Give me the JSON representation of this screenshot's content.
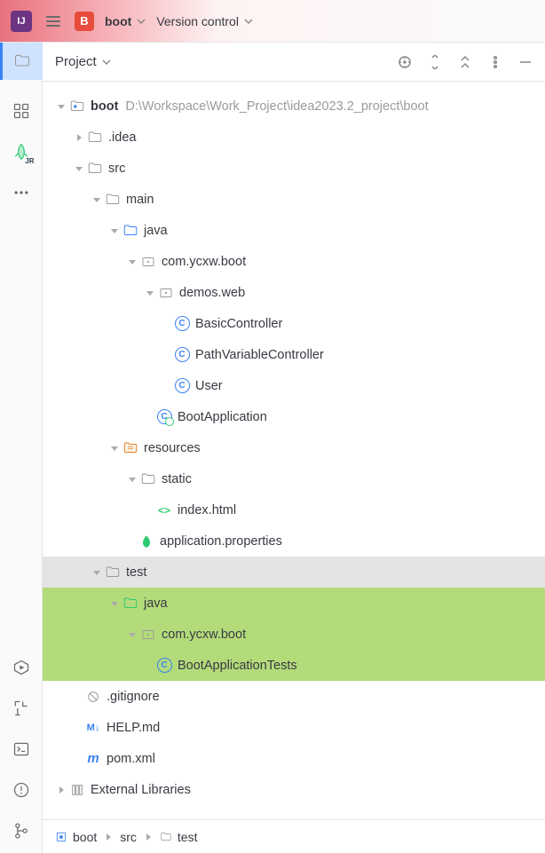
{
  "titlebar": {
    "project_badge": "B",
    "project_name": "boot",
    "vcs": "Version control"
  },
  "panel": {
    "title": "Project"
  },
  "tree": {
    "root": {
      "label": "boot",
      "path": "D:\\Workspace\\Work_Project\\idea2023.2_project\\boot"
    },
    "idea": ".idea",
    "src": "src",
    "main": "main",
    "java": "java",
    "pkg_main": "com.ycxw.boot",
    "demos": "demos.web",
    "basic": "BasicController",
    "pathvar": "PathVariableController",
    "user": "User",
    "bootapp": "BootApplication",
    "resources": "resources",
    "static": "static",
    "indexhtml": "index.html",
    "appprops": "application.properties",
    "test": "test",
    "test_java": "java",
    "pkg_test": "com.ycxw.boot",
    "boottests": "BootApplicationTests",
    "gitignore": ".gitignore",
    "helpmd": "HELP.md",
    "pom": "pom.xml",
    "extlibs": "External Libraries"
  },
  "breadcrumb": {
    "b0": "boot",
    "b1": "src",
    "b2": "test"
  }
}
